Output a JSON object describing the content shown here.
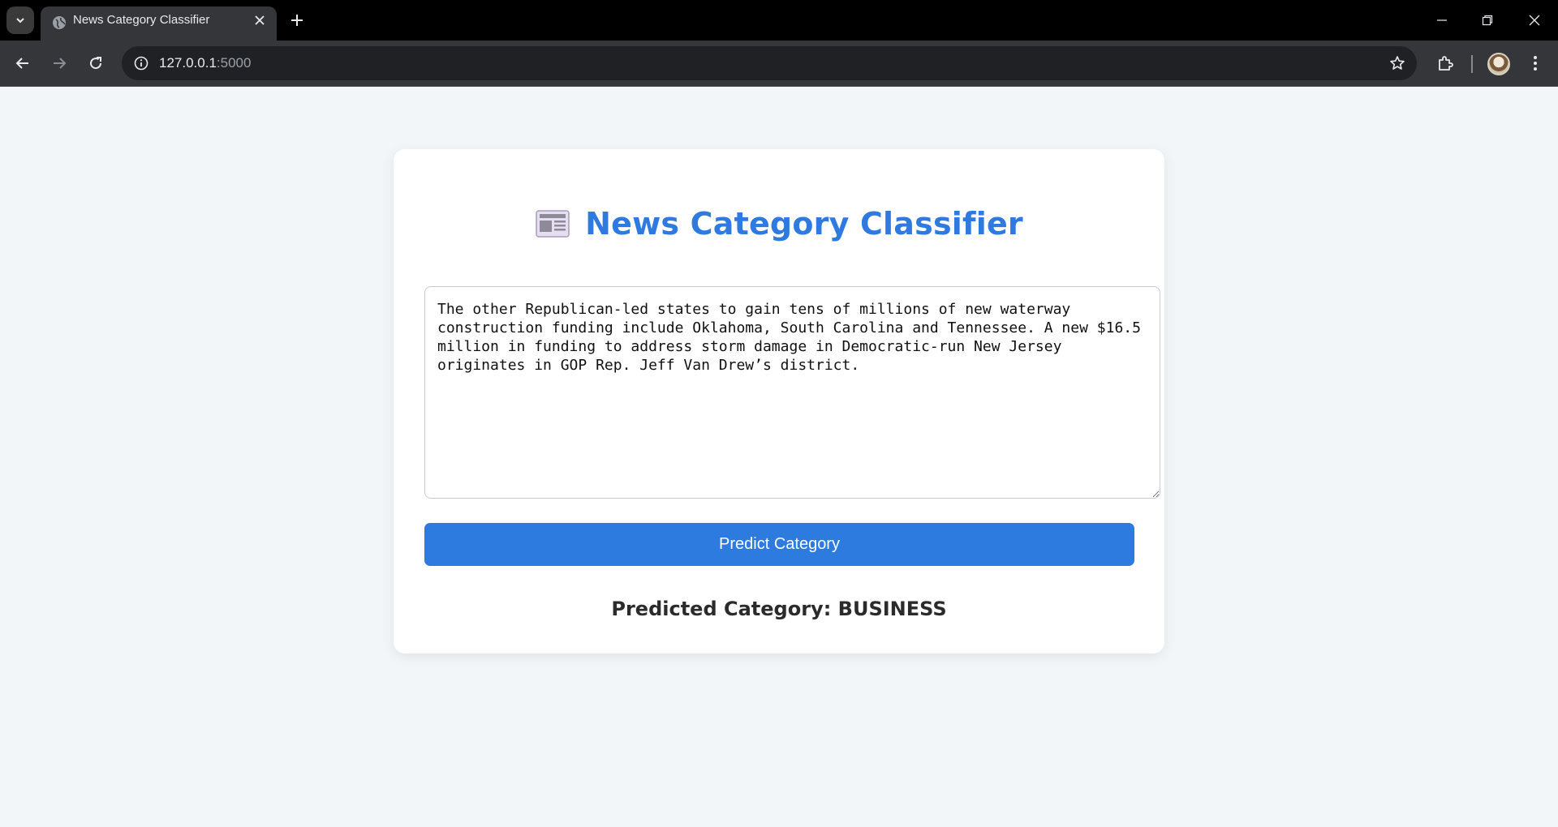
{
  "browser": {
    "tab_title": "News Category Classifier",
    "url_host": "127.0.0.1",
    "url_port": ":5000",
    "icons": [
      "tab-search-icon",
      "globe-icon",
      "close-icon",
      "plus-icon",
      "minimize-icon",
      "restore-icon",
      "window-close-icon",
      "back-arrow-icon",
      "forward-arrow-icon",
      "reload-icon",
      "info-icon",
      "star-icon",
      "extensions-icon",
      "profile-avatar",
      "more-vert-icon"
    ]
  },
  "page": {
    "title": "News Category Classifier",
    "title_icon": "newspaper-icon",
    "accent_color": "#2f7ae0",
    "article_text": "The other Republican-led states to gain tens of millions of new waterway construction funding include Oklahoma, South Carolina and Tennessee. A new $16.5 million in funding to address storm damage in Democratic-run New Jersey originates in GOP Rep. Jeff Van Drew’s district.",
    "predict_button_label": "Predict Category",
    "result_text": "Predicted Category: BUSINESS"
  }
}
